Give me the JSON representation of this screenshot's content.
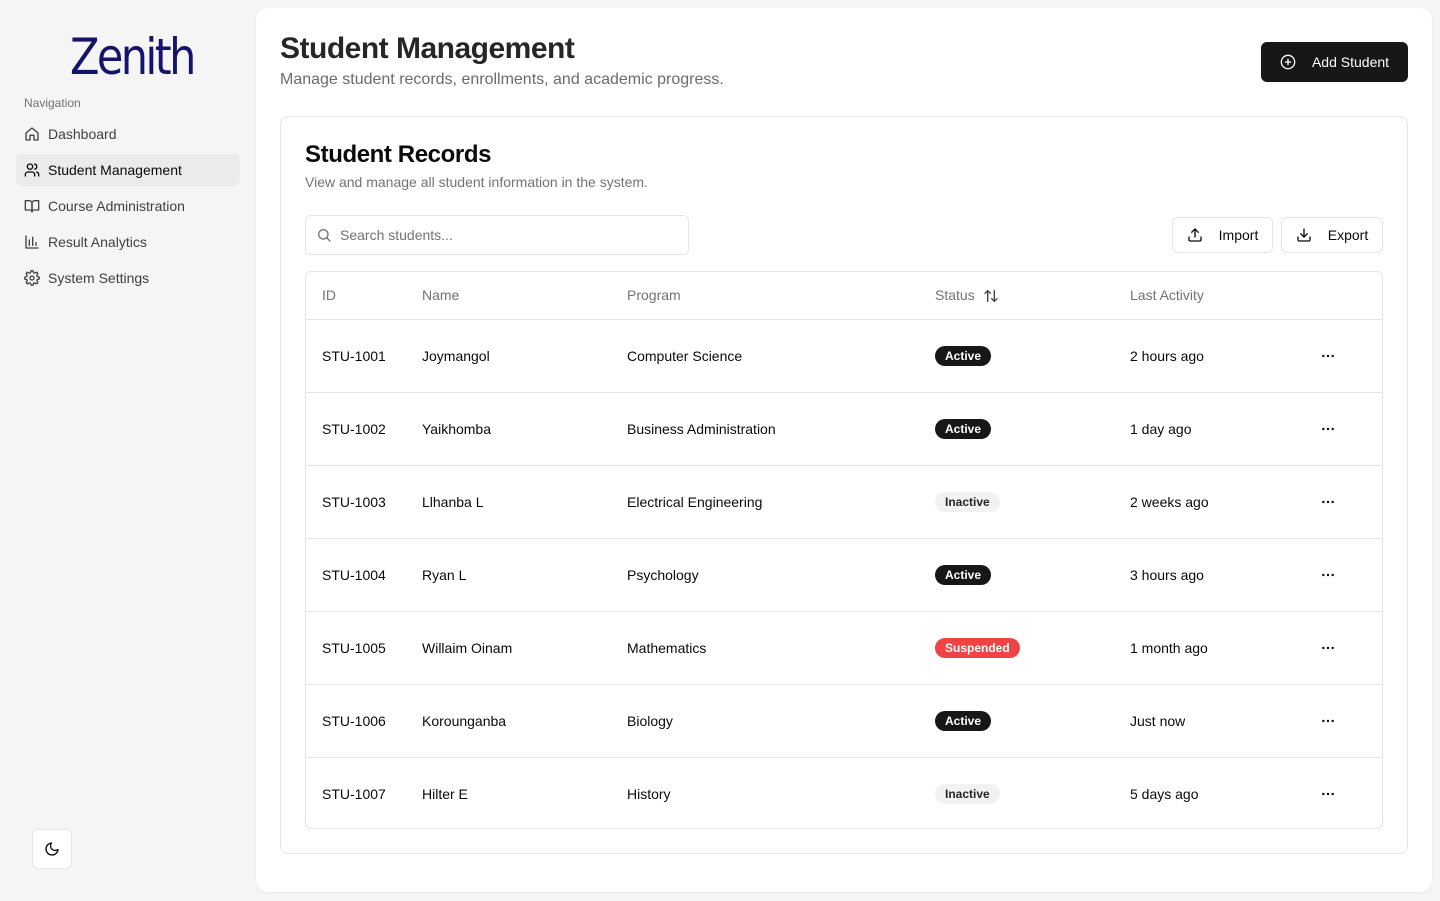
{
  "app": {
    "logo": "Zenith"
  },
  "sidebar": {
    "heading": "Navigation",
    "items": [
      {
        "label": "Dashboard",
        "icon": "home-icon",
        "active": false
      },
      {
        "label": "Student Management",
        "icon": "users-icon",
        "active": true
      },
      {
        "label": "Course Administration",
        "icon": "book-icon",
        "active": false
      },
      {
        "label": "Result Analytics",
        "icon": "bar-chart-icon",
        "active": false
      },
      {
        "label": "System Settings",
        "icon": "gear-icon",
        "active": false
      }
    ],
    "theme_toggle_icon": "moon-icon"
  },
  "header": {
    "title": "Student Management",
    "subtitle": "Manage student records, enrollments, and academic progress.",
    "add_button": "Add Student"
  },
  "card": {
    "title": "Student Records",
    "subtitle": "View and manage all student information in the system.",
    "search_placeholder": "Search students...",
    "import_label": "Import",
    "export_label": "Export"
  },
  "table": {
    "columns": [
      "ID",
      "Name",
      "Program",
      "Status",
      "Last Activity"
    ],
    "rows": [
      {
        "id": "STU-1001",
        "name": "Joymangol",
        "program": "Computer Science",
        "status": "Active",
        "activity": "2 hours ago"
      },
      {
        "id": "STU-1002",
        "name": "Yaikhomba",
        "program": "Business Administration",
        "status": "Active",
        "activity": "1 day ago"
      },
      {
        "id": "STU-1003",
        "name": "Llhanba L",
        "program": "Electrical Engineering",
        "status": "Inactive",
        "activity": "2 weeks ago"
      },
      {
        "id": "STU-1004",
        "name": "Ryan L",
        "program": "Psychology",
        "status": "Active",
        "activity": "3 hours ago"
      },
      {
        "id": "STU-1005",
        "name": "Willaim Oinam",
        "program": "Mathematics",
        "status": "Suspended",
        "activity": "1 month ago"
      },
      {
        "id": "STU-1006",
        "name": "Korounganba",
        "program": "Biology",
        "status": "Active",
        "activity": "Just now"
      },
      {
        "id": "STU-1007",
        "name": "Hilter E",
        "program": "History",
        "status": "Inactive",
        "activity": "5 days ago"
      }
    ]
  },
  "colors": {
    "primary": "#171717",
    "logo": "#16136b",
    "suspended": "#ef4444",
    "inactive_bg": "#f2f2f2"
  }
}
